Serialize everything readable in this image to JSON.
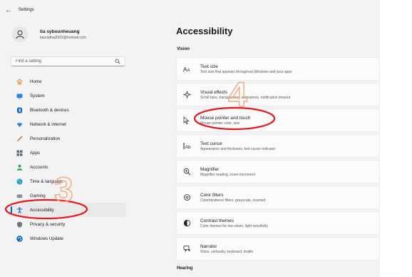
{
  "window": {
    "title": "Settings"
  },
  "profile": {
    "name": "tia sybounheuang",
    "email": "tiaorlathai2022@hotmail.com"
  },
  "search": {
    "placeholder": "Find a setting"
  },
  "sidebar": {
    "items": [
      {
        "label": "Home",
        "icon": "home-icon"
      },
      {
        "label": "System",
        "icon": "system-icon"
      },
      {
        "label": "Bluetooth & devices",
        "icon": "bluetooth-icon"
      },
      {
        "label": "Network & internet",
        "icon": "wifi-icon"
      },
      {
        "label": "Personalization",
        "icon": "brush-icon"
      },
      {
        "label": "Apps",
        "icon": "apps-icon"
      },
      {
        "label": "Accounts",
        "icon": "accounts-icon"
      },
      {
        "label": "Time & language",
        "icon": "globe-icon"
      },
      {
        "label": "Gaming",
        "icon": "gaming-icon"
      },
      {
        "label": "Accessibility",
        "icon": "accessibility-icon",
        "active": true
      },
      {
        "label": "Privacy & security",
        "icon": "shield-icon"
      },
      {
        "label": "Windows Update",
        "icon": "update-icon"
      }
    ]
  },
  "main": {
    "title": "Accessibility",
    "section_vision": "Vision",
    "section_hearing": "Hearing",
    "cards": [
      {
        "title": "Text size",
        "subtitle": "Text size that appears throughout Windows and your apps",
        "icon": "text-size-icon"
      },
      {
        "title": "Visual effects",
        "subtitle": "Scroll bars, transparency, animations, notification timeout",
        "icon": "visual-effects-icon"
      },
      {
        "title": "Mouse pointer and touch",
        "subtitle": "Mouse pointer color, size",
        "icon": "mouse-pointer-icon"
      },
      {
        "title": "Text cursor",
        "subtitle": "Appearance and thickness, text cursor indicator",
        "icon": "text-cursor-icon"
      },
      {
        "title": "Magnifier",
        "subtitle": "Magnifier reading, zoom increment",
        "icon": "magnifier-icon"
      },
      {
        "title": "Color filters",
        "subtitle": "Colorblindness filters, grayscale, inverted",
        "icon": "color-filters-icon"
      },
      {
        "title": "Contrast themes",
        "subtitle": "Color themes for low vision, light sensitivity",
        "icon": "contrast-icon"
      },
      {
        "title": "Narrator",
        "subtitle": "Voice, verbosity, keyboard, braille",
        "icon": "narrator-icon"
      }
    ]
  },
  "annotations": {
    "step_left": "3",
    "step_right": "4",
    "annotation_color": "#e8171d",
    "number_color": "#f3a87f"
  },
  "colors": {
    "accent": "#0067c0"
  }
}
